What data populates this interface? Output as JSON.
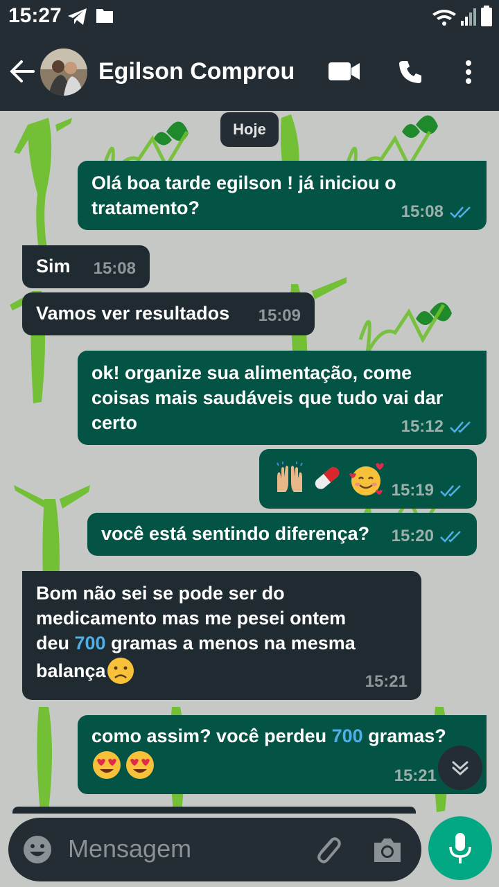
{
  "status_bar": {
    "time": "15:27"
  },
  "header": {
    "contact_name": "Egilson Comprou"
  },
  "chat": {
    "date_chip": "Hoje",
    "messages": [
      {
        "dir": "out",
        "lines": [
          "Olá boa tarde egilson ! já iniciou o",
          "tratamento?"
        ],
        "time": "15:08"
      },
      {
        "dir": "in",
        "lines": [
          "Sim"
        ],
        "time": "15:08"
      },
      {
        "dir": "in",
        "lines": [
          "Vamos ver resultados"
        ],
        "time": "15:09"
      },
      {
        "dir": "out",
        "lines": [
          "ok! organize sua alimentação, come",
          "coisas mais saudáveis que tudo vai dar",
          "certo"
        ],
        "time": "15:12"
      },
      {
        "dir": "out",
        "emojis": [
          "raising-hands",
          "pill",
          "smiling-face-with-hearts"
        ],
        "time": "15:19"
      },
      {
        "dir": "out",
        "lines": [
          "você está sentindo diferença?"
        ],
        "time": "15:20"
      },
      {
        "dir": "in",
        "lines": [
          "Bom não sei se pode ser do",
          "medicamento mas me pesei ontem"
        ],
        "line3_pre": "deu ",
        "line3_num": "700",
        "line3_post": " gramas a menos na mesma",
        "line4": "balança",
        "time": "15:21"
      },
      {
        "dir": "out",
        "line1_pre": "como assim? você perdeu ",
        "line1_num": "700",
        "line1_post": " gramas?",
        "emojis": [
          "heart-eyes",
          "heart-eyes"
        ],
        "time": "15:21"
      }
    ]
  },
  "input": {
    "placeholder": "Mensagem"
  },
  "icons": {
    "back": "arrow-left-icon",
    "video": "video-call-icon",
    "call": "phone-icon",
    "menu": "more-vert-icon",
    "emoji": "emoji-icon",
    "attach": "paperclip-icon",
    "camera": "camera-icon",
    "mic": "microphone-icon",
    "scroll": "chevron-double-down-icon",
    "read": "double-check-icon"
  },
  "colors": {
    "header_bg": "#232d33",
    "outgoing_bubble": "#045446",
    "incoming_bubble": "#1f2b31",
    "read_tick": "#4fb0e8",
    "mic_button": "#02a884",
    "wallpaper_green": "#6fbf2e"
  }
}
